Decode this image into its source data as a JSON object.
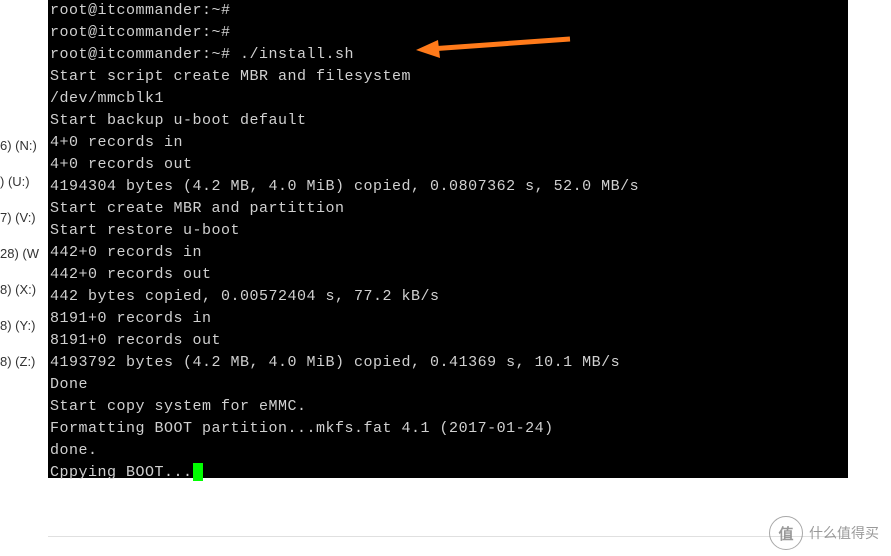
{
  "sidebar": {
    "items": [
      {
        "label": "6) (N:)"
      },
      {
        "label": ") (U:)"
      },
      {
        "label": "7) (V:)"
      },
      {
        "label": "28) (W"
      },
      {
        "label": "8) (X:)"
      },
      {
        "label": "8) (Y:)"
      },
      {
        "label": "8) (Z:)"
      }
    ]
  },
  "terminal": {
    "lines": [
      "root@itcommander:~#",
      "root@itcommander:~#",
      "root@itcommander:~# ./install.sh",
      "Start script create MBR and filesystem",
      "/dev/mmcblk1",
      "Start backup u-boot default",
      "4+0 records in",
      "4+0 records out",
      "4194304 bytes (4.2 MB, 4.0 MiB) copied, 0.0807362 s, 52.0 MB/s",
      "Start create MBR and partittion",
      "Start restore u-boot",
      "442+0 records in",
      "442+0 records out",
      "442 bytes copied, 0.00572404 s, 77.2 kB/s",
      "8191+0 records in",
      "8191+0 records out",
      "4193792 bytes (4.2 MB, 4.0 MiB) copied, 0.41369 s, 10.1 MB/s",
      "Done",
      "Start copy system for eMMC.",
      "Formatting BOOT partition...mkfs.fat 4.1 (2017-01-24)",
      "done.",
      "Cppying BOOT..."
    ]
  },
  "watermark": {
    "badge": "值",
    "text": "什么值得买"
  },
  "annotation": {
    "arrow_target": "./install.sh"
  }
}
